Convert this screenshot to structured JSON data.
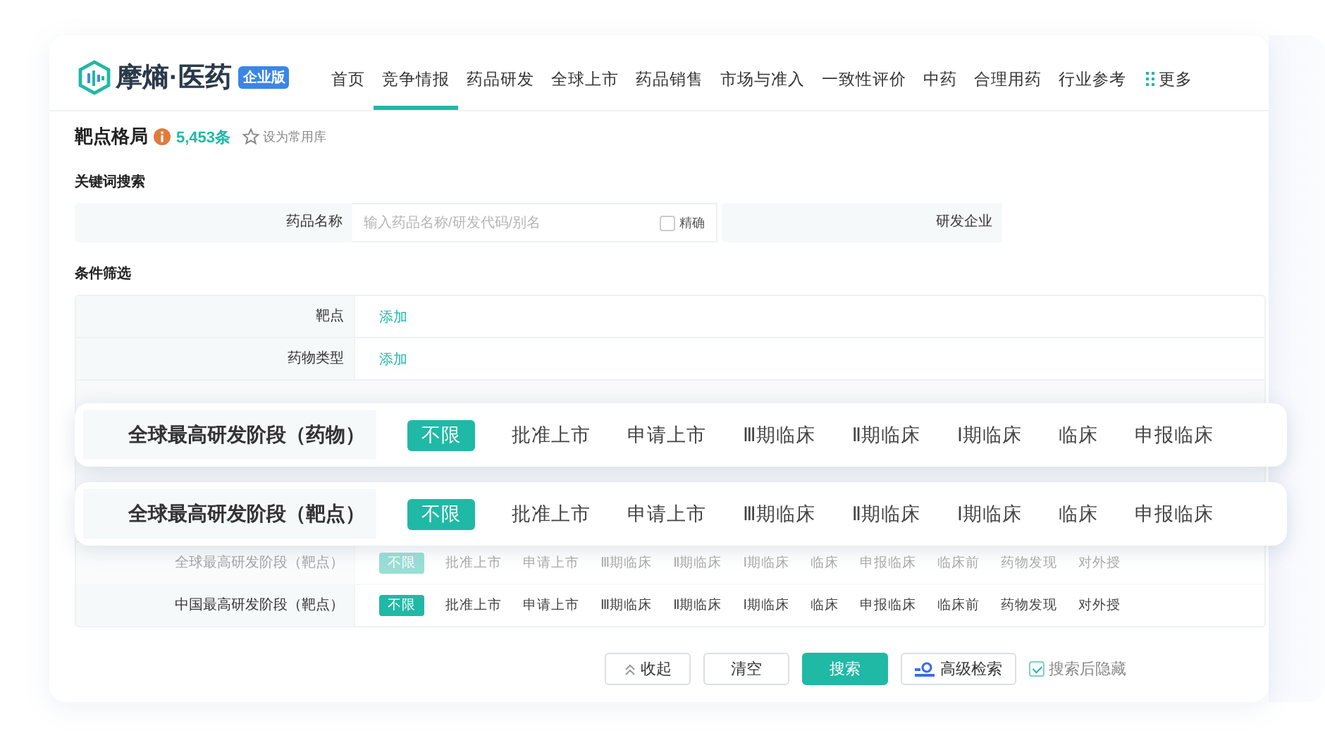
{
  "nav": {
    "logo": {
      "name": "摩熵·医药",
      "badge": "企业版"
    },
    "items": [
      {
        "label": "首页",
        "selected": false
      },
      {
        "label": "竞争情报",
        "selected": true
      },
      {
        "label": "药品研发",
        "selected": false
      },
      {
        "label": "全球上市",
        "selected": false
      },
      {
        "label": "药品销售",
        "selected": false
      },
      {
        "label": "市场与准入",
        "selected": false
      },
      {
        "label": "一致性评价",
        "selected": false
      },
      {
        "label": "中药",
        "selected": false
      },
      {
        "label": "合理用药",
        "selected": false
      },
      {
        "label": "行业参考",
        "selected": false
      }
    ],
    "more": "更多"
  },
  "page_header": {
    "title": "靶点格局",
    "count": "5,453条",
    "favorite": "设为常用库"
  },
  "keyword_search": {
    "title": "关键词搜索",
    "fields": [
      {
        "label": "药品名称",
        "placeholder": "输入药品名称/研发代码/别名",
        "exact": {
          "label": "精确",
          "checked": false
        }
      },
      {
        "label": "研发企业"
      }
    ]
  },
  "filters": {
    "title": "条件筛选",
    "rows": [
      {
        "label": "靶点",
        "kind": "add",
        "faded": false,
        "action": "添加"
      },
      {
        "label": "药物类型",
        "kind": "add",
        "faded": false,
        "action": "添加"
      },
      {
        "kind": "covered"
      },
      {
        "label": "全球最高研发阶段（靶点）",
        "kind": "options",
        "faded": true,
        "options": [
          {
            "label": "不限",
            "selected": true
          },
          {
            "label": "批准上市",
            "selected": false
          },
          {
            "label": "申请上市",
            "selected": false
          },
          {
            "label": "Ⅲ期临床",
            "selected": false
          },
          {
            "label": "Ⅱ期临床",
            "selected": false
          },
          {
            "label": "Ⅰ期临床",
            "selected": false
          },
          {
            "label": "临床",
            "selected": false
          },
          {
            "label": "申报临床",
            "selected": false
          },
          {
            "label": "临床前",
            "selected": false
          },
          {
            "label": "药物发现",
            "selected": false
          },
          {
            "label": "对外授",
            "selected": false
          }
        ]
      },
      {
        "label": "中国最高研发阶段（靶点）",
        "kind": "options",
        "faded": false,
        "options": [
          {
            "label": "不限",
            "selected": true
          },
          {
            "label": "批准上市",
            "selected": false
          },
          {
            "label": "申请上市",
            "selected": false
          },
          {
            "label": "Ⅲ期临床",
            "selected": false
          },
          {
            "label": "Ⅱ期临床",
            "selected": false
          },
          {
            "label": "Ⅰ期临床",
            "selected": false
          },
          {
            "label": "临床",
            "selected": false
          },
          {
            "label": "申报临床",
            "selected": false
          },
          {
            "label": "临床前",
            "selected": false
          },
          {
            "label": "药物发现",
            "selected": false
          },
          {
            "label": "对外授",
            "selected": false
          }
        ]
      }
    ]
  },
  "highlight_cards": [
    {
      "label": "全球最高研发阶段（药物）",
      "options": [
        {
          "label": "不限",
          "selected": true
        },
        {
          "label": "批准上市",
          "selected": false
        },
        {
          "label": "申请上市",
          "selected": false
        },
        {
          "label": "Ⅲ期临床",
          "selected": false
        },
        {
          "label": "Ⅱ期临床",
          "selected": false
        },
        {
          "label": "Ⅰ期临床",
          "selected": false
        },
        {
          "label": "临床",
          "selected": false
        },
        {
          "label": "申报临床",
          "selected": false
        }
      ]
    },
    {
      "label": "全球最高研发阶段（靶点）",
      "options": [
        {
          "label": "不限",
          "selected": true
        },
        {
          "label": "批准上市",
          "selected": false
        },
        {
          "label": "申请上市",
          "selected": false
        },
        {
          "label": "Ⅲ期临床",
          "selected": false
        },
        {
          "label": "Ⅱ期临床",
          "selected": false
        },
        {
          "label": "Ⅰ期临床",
          "selected": false
        },
        {
          "label": "临床",
          "selected": false
        },
        {
          "label": "申报临床",
          "selected": false
        }
      ]
    }
  ],
  "actions": {
    "collapse": "收起",
    "clear": "清空",
    "search": "搜索",
    "advanced": "高级检索",
    "hide_after": {
      "label": "搜索后隐藏",
      "checked": true
    }
  }
}
